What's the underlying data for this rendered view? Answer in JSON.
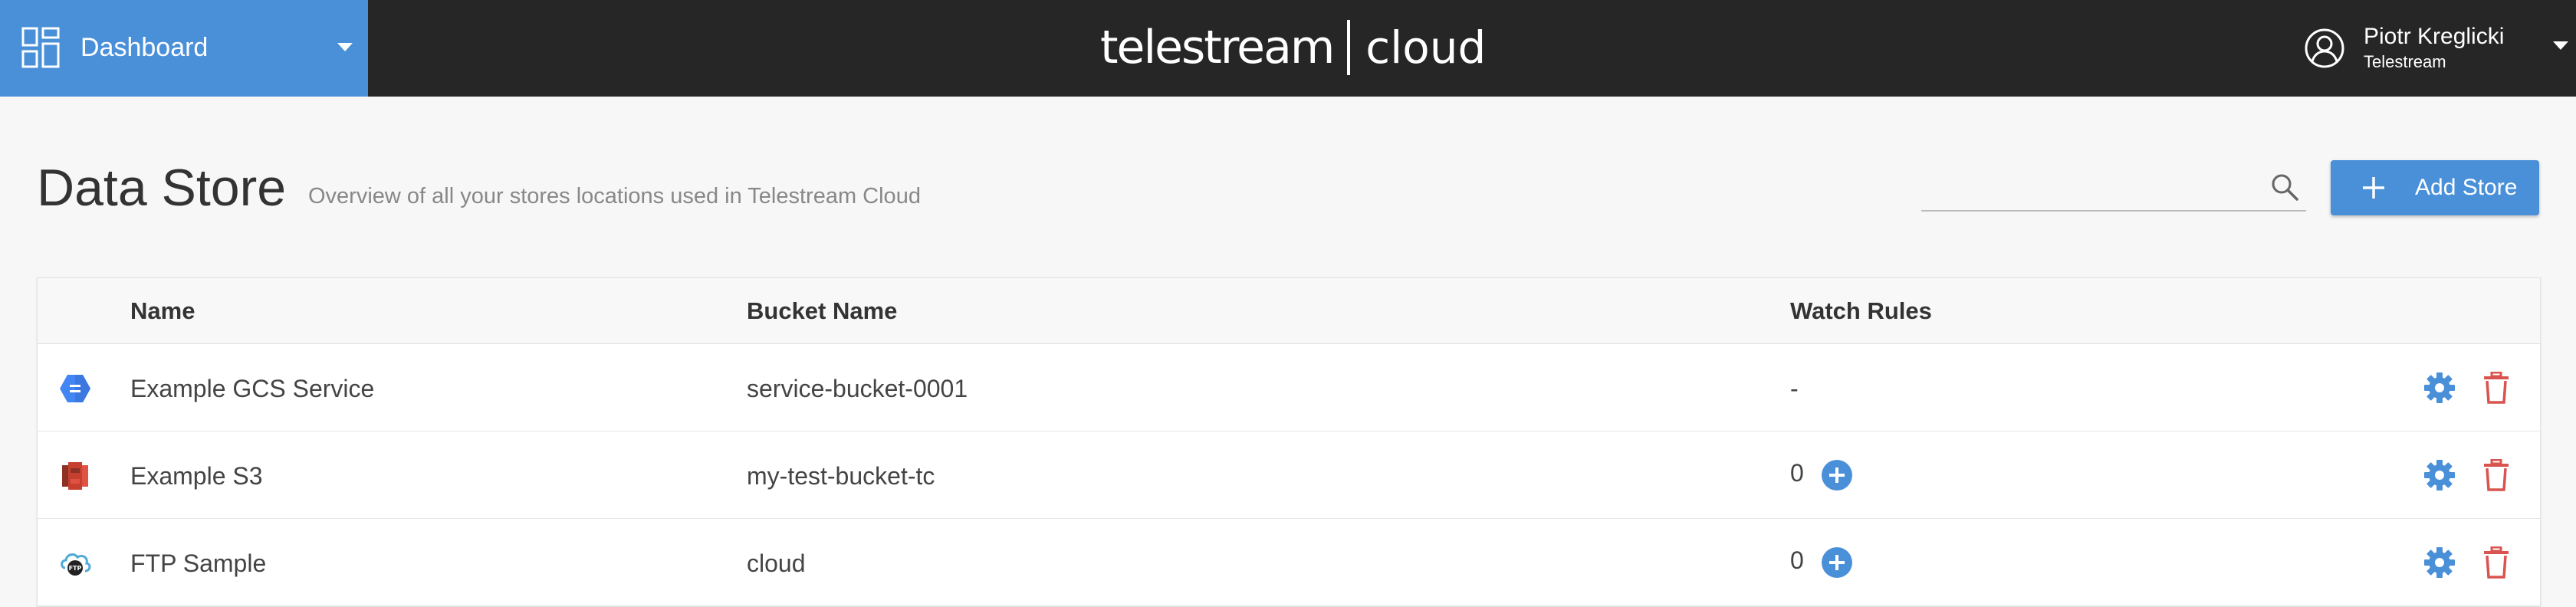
{
  "header": {
    "menu_label": "Dashboard",
    "brand_name": "telestream",
    "brand_product": "cloud",
    "user_name": "Piotr Kreglicki",
    "user_org": "Telestream"
  },
  "page": {
    "title": "Data Store",
    "subtitle": "Overview of all your stores locations used in Telestream Cloud"
  },
  "search": {
    "value": "",
    "placeholder": ""
  },
  "actions": {
    "add_store_label": "Add Store"
  },
  "table": {
    "columns": [
      "Name",
      "Bucket Name",
      "Watch Rules"
    ],
    "rows": [
      {
        "icon": "gcs-icon",
        "name": "Example GCS Service",
        "bucket": "service-bucket-0001",
        "watch_rules": "-"
      },
      {
        "icon": "s3-icon",
        "name": "Example S3",
        "bucket": "my-test-bucket-tc",
        "watch_rules": "0"
      },
      {
        "icon": "ftp-icon",
        "name": "FTP Sample",
        "bucket": "cloud",
        "watch_rules": "0"
      }
    ]
  },
  "colors": {
    "accent": "#4a90d9",
    "topbar": "#262626",
    "danger": "#d9534f",
    "background": "#f7f7f7"
  }
}
